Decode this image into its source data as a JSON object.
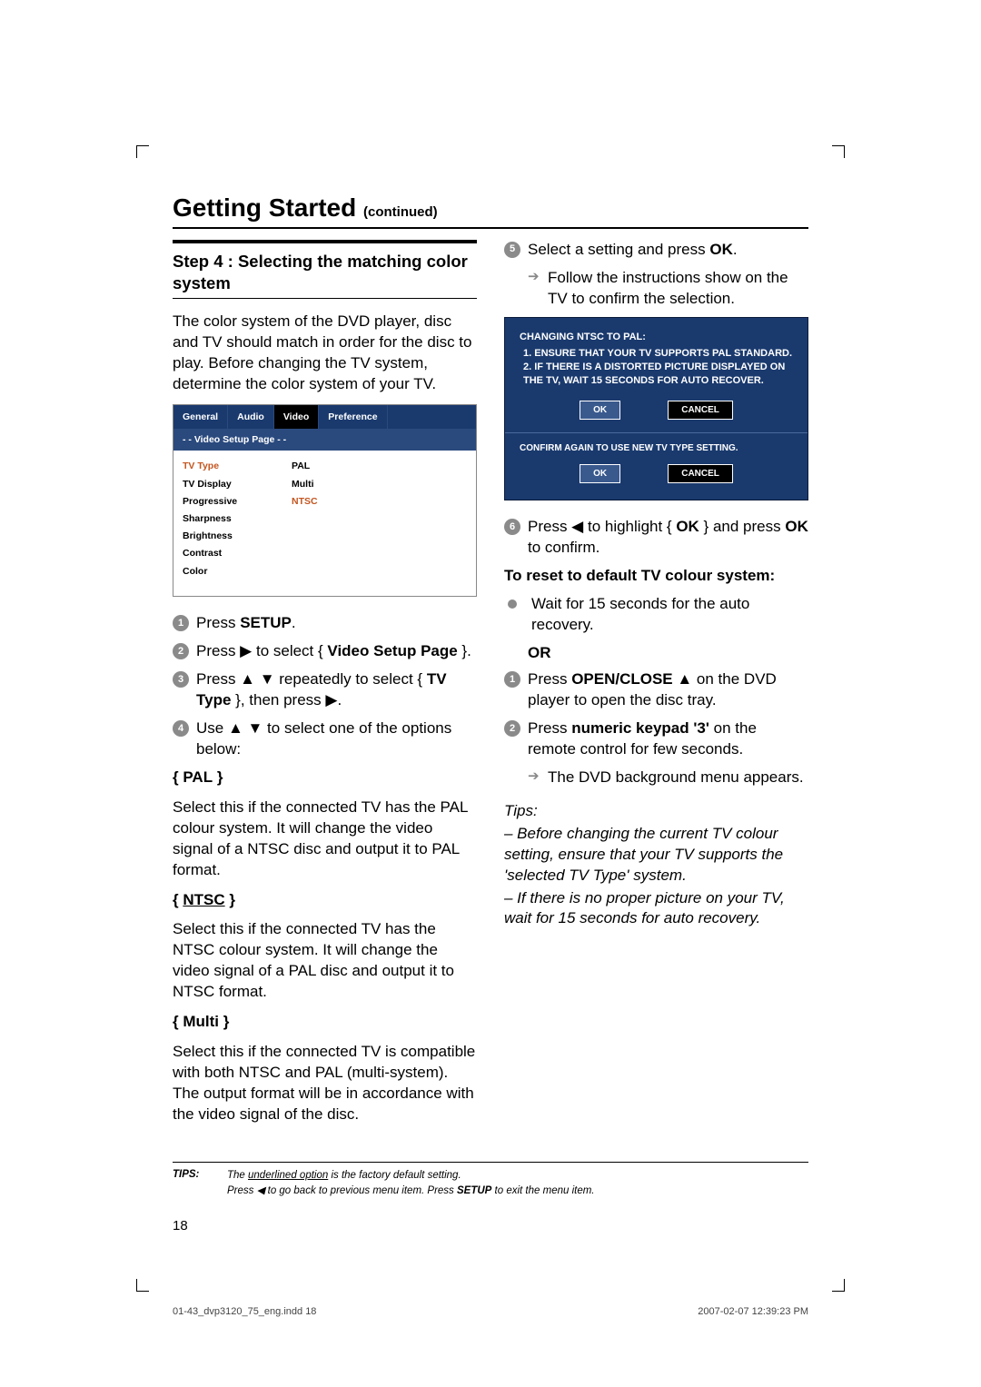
{
  "title": "Getting Started",
  "title_cont": "(continued)",
  "step_heading": "Step 4 : Selecting the matching color system",
  "intro": "The color system of the DVD player, disc and TV should match in order for the disc to play. Before changing the TV system, determine the color system of your TV.",
  "menu": {
    "tabs": [
      "General",
      "Audio",
      "Video",
      "Preference"
    ],
    "subhead": "- -   Video Setup Page   - -",
    "left": [
      "TV Type",
      "TV Display",
      "Progressive",
      "Sharpness",
      "Brightness",
      "Contrast",
      "Color"
    ],
    "right": [
      "PAL",
      "Multi",
      "NTSC"
    ]
  },
  "steps_left": [
    {
      "n": "1",
      "pre": "Press ",
      "bold": "SETUP",
      "post": "."
    },
    {
      "n": "2",
      "pre": "Press ▶ to select { ",
      "bold": "Video Setup Page",
      "post": " }."
    },
    {
      "n": "3",
      "pre": "Press ▲ ▼ repeatedly to select { ",
      "bold": "TV Type",
      "post": " }, then press ▶."
    },
    {
      "n": "4",
      "pre": "Use ▲ ▼ to select one of the options below:",
      "bold": "",
      "post": ""
    }
  ],
  "options": [
    {
      "head": "{ PAL }",
      "underline": false,
      "body": "Select this if the connected TV has the PAL colour system. It will change the video signal of a NTSC disc and output it to PAL format."
    },
    {
      "head": "{ NTSC }",
      "underline": true,
      "body": "Select this if the connected TV has the NTSC colour system. It will change the video signal of a PAL disc and output it to NTSC format."
    },
    {
      "head": "{ Multi }",
      "underline": false,
      "body": "Select this if the connected TV is compatible with both NTSC and PAL (multi-system). The output format will be in accordance with the video signal of the disc."
    }
  ],
  "right_top": {
    "n": "5",
    "line1a": "Select a setting and press ",
    "line1b": "OK",
    "line1c": ".",
    "sub": "Follow the instructions show on the TV to confirm the selection."
  },
  "bluebox": {
    "title": "CHANGING NTSC TO PAL:",
    "l1": "1. ENSURE THAT YOUR TV SUPPORTS PAL STANDARD.",
    "l2": "2. IF THERE IS A DISTORTED PICTURE DISPLAYED ON THE TV, WAIT 15 SECONDS FOR AUTO RECOVER.",
    "ok": "OK",
    "cancel": "CANCEL",
    "confirm": "CONFIRM AGAIN TO USE NEW TV TYPE SETTING."
  },
  "step6": {
    "n": "6",
    "pre": "Press ◀ to highlight { ",
    "bold1": "OK",
    "mid": " } and press ",
    "bold2": "OK",
    "post": " to confirm."
  },
  "reset_head": "To reset to default TV colour system:",
  "reset_wait": "Wait for 15 seconds for the auto recovery.",
  "reset_or": "OR",
  "reset1": {
    "n": "1",
    "pre": "Press ",
    "bold": "OPEN/CLOSE ▲",
    "post": " on the DVD player to open the disc tray."
  },
  "reset2": {
    "n": "2",
    "pre": "Press ",
    "bold": "numeric keypad '3'",
    "post": " on the remote control for few seconds."
  },
  "reset2_sub": "The DVD background menu appears.",
  "tips_block": {
    "head": "Tips:",
    "t1": "– Before changing the current TV colour setting, ensure that your TV supports the 'selected TV Type' system.",
    "t2": "– If there is no proper picture on your TV, wait for 15 seconds for auto recovery."
  },
  "footer_tips": {
    "label": "TIPS:",
    "line1a": "The ",
    "line1u": "underlined option",
    "line1b": " is the factory default setting.",
    "line2a": "Press ◀ to go back to previous menu item. Press ",
    "line2b": "SETUP",
    "line2c": " to exit the menu item."
  },
  "pagenum": "18",
  "imprint_left": "01-43_dvp3120_75_eng.indd   18",
  "imprint_right": "2007-02-07   12:39:23 PM"
}
